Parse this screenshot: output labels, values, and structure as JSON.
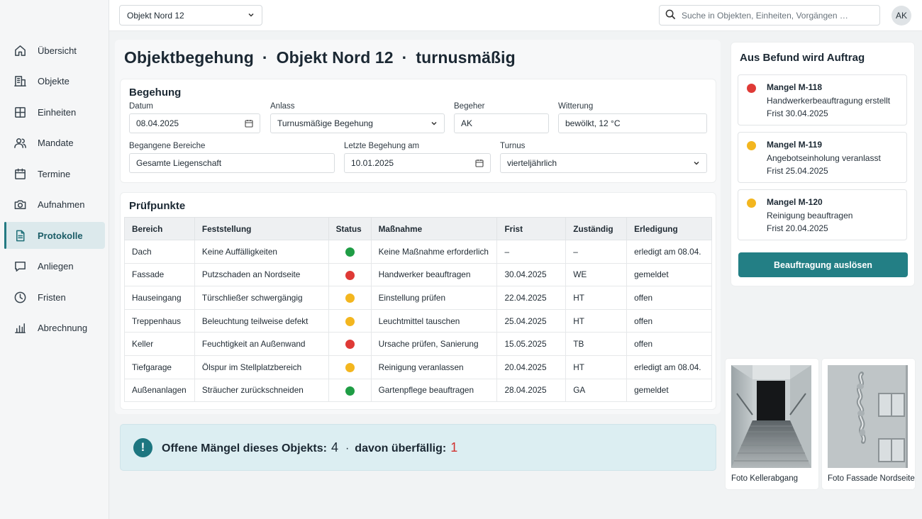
{
  "topbar": {
    "object_select": "Objekt Nord 12",
    "search_placeholder": "Suche in Objekten, Einheiten, Vorgängen …",
    "avatar": "AK"
  },
  "sidebar": {
    "items": [
      {
        "label": "Übersicht",
        "icon": "home-icon"
      },
      {
        "label": "Objekte",
        "icon": "building-icon"
      },
      {
        "label": "Einheiten",
        "icon": "grid-icon"
      },
      {
        "label": "Mandate",
        "icon": "users-icon"
      },
      {
        "label": "Termine",
        "icon": "calendar-icon"
      },
      {
        "label": "Aufnahmen",
        "icon": "camera-icon"
      },
      {
        "label": "Protokolle",
        "icon": "document-icon",
        "active": true
      },
      {
        "label": "Anliegen",
        "icon": "chat-icon"
      },
      {
        "label": "Fristen",
        "icon": "clock-icon"
      },
      {
        "label": "Abrechnung",
        "icon": "bar-chart-icon"
      }
    ]
  },
  "header": {
    "title_part1": "Objektbegehung",
    "title_part2": "Objekt Nord 12",
    "title_part3": "turnusmäßig",
    "separator": "·"
  },
  "begehung": {
    "title": "Begehung",
    "datum_label": "Datum",
    "datum_value": "08.04.2025",
    "anlass_label": "Anlass",
    "anlass_value": "Turnusmäßige Begehung",
    "begeher_label": "Begeher",
    "begeher_value": "AK",
    "witterung_label": "Witterung",
    "witterung_value": "bewölkt, 12 °C",
    "bereiche_label": "Begangene Bereiche",
    "bereiche_value": "Gesamte Liegenschaft",
    "letzte_label": "Letzte Begehung am",
    "letzte_value": "10.01.2025",
    "turnus_label": "Turnus",
    "turnus_value": "vierteljährlich"
  },
  "pruefpunkte": {
    "title": "Prüfpunkte",
    "columns": [
      "Bereich",
      "Feststellung",
      "Status",
      "Maßnahme",
      "Frist",
      "Zuständig",
      "Erledigung"
    ],
    "status_colors": {
      "green": "#1f9d45",
      "red": "#df3a36",
      "yellow": "#f3b61f"
    },
    "rows": [
      {
        "bereich": "Dach",
        "feststellung": "Keine Auffälligkeiten",
        "status": "green",
        "massnahme": "Keine Maßnahme erforderlich",
        "frist": "–",
        "zustaendig": "–",
        "erledigung": "erledigt am 08.04."
      },
      {
        "bereich": "Fassade",
        "feststellung": "Putzschaden an Nordseite",
        "status": "red",
        "massnahme": "Handwerker beauftragen",
        "frist": "30.04.2025",
        "zustaendig": "WE",
        "erledigung": "gemeldet"
      },
      {
        "bereich": "Hauseingang",
        "feststellung": "Türschließer schwergängig",
        "status": "yellow",
        "massnahme": "Einstellung prüfen",
        "frist": "22.04.2025",
        "zustaendig": "HT",
        "erledigung": "offen"
      },
      {
        "bereich": "Treppenhaus",
        "feststellung": "Beleuchtung teilweise defekt",
        "status": "yellow",
        "massnahme": "Leuchtmittel tauschen",
        "frist": "25.04.2025",
        "zustaendig": "HT",
        "erledigung": "offen"
      },
      {
        "bereich": "Keller",
        "feststellung": "Feuchtigkeit an Außenwand",
        "status": "red",
        "massnahme": "Ursache prüfen, Sanierung",
        "frist": "15.05.2025",
        "zustaendig": "TB",
        "erledigung": "offen"
      },
      {
        "bereich": "Tiefgarage",
        "feststellung": "Ölspur im Stellplatzbereich",
        "status": "yellow",
        "massnahme": "Reinigung veranlassen",
        "frist": "20.04.2025",
        "zustaendig": "HT",
        "erledigung": "erledigt am 08.04."
      },
      {
        "bereich": "Außenanlagen",
        "feststellung": "Sträucher zurückschneiden",
        "status": "green",
        "massnahme": "Gartenpflege beauftragen",
        "frist": "28.04.2025",
        "zustaendig": "GA",
        "erledigung": "gemeldet"
      }
    ]
  },
  "banner": {
    "text": "Offene Mängel dieses Objekts:",
    "open_count": "4",
    "separator": "·",
    "overdue_text": "davon überfällig:",
    "overdue_count": "1"
  },
  "befund": {
    "title": "Aus Befund wird Auftrag",
    "defects": [
      {
        "title": "Mangel M-118",
        "line1": "Handwerkerbeauftragung erstellt",
        "line2": "Frist 30.04.2025",
        "color": "#df3a36"
      },
      {
        "title": "Mangel M-119",
        "line1": "Angebotseinholung veranlasst",
        "line2": "Frist 25.04.2025",
        "color": "#f3b61f"
      },
      {
        "title": "Mangel M-120",
        "line1": "Reinigung beauftragen",
        "line2": "Frist 20.04.2025",
        "color": "#f3b61f"
      }
    ],
    "button_label": "Beauftragung auslösen"
  },
  "photos": [
    {
      "caption": "Foto Kellerabgang"
    },
    {
      "caption": "Foto Fassade Nordseite"
    }
  ]
}
